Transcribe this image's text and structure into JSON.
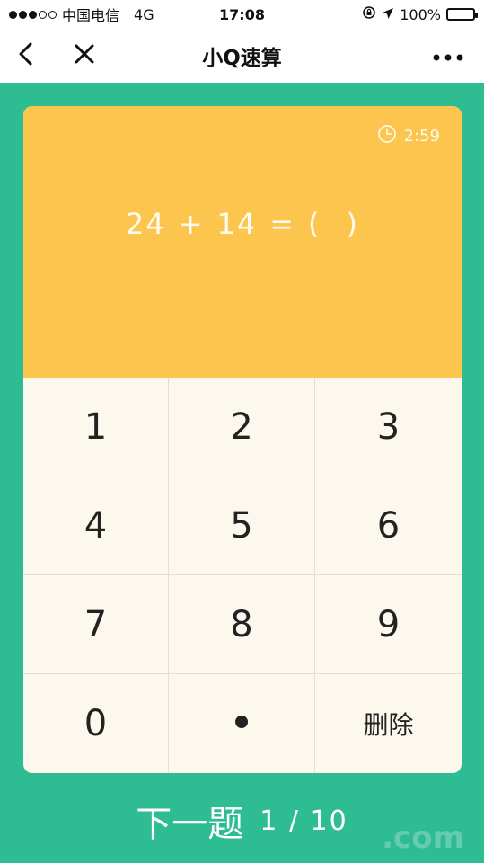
{
  "status_bar": {
    "carrier": "中国电信",
    "network": "4G",
    "time": "17:08",
    "battery_percent": "100%",
    "battery_level": 1.0,
    "signal_filled": 3,
    "signal_total": 5
  },
  "nav": {
    "title": "小Q速算",
    "back_icon": "chevron-left-icon",
    "close_icon": "close-icon",
    "more_icon": "more-dots-icon"
  },
  "question": {
    "timer": "2:59",
    "left_operand": "24",
    "operator": "+",
    "right_operand": "14",
    "equals": "=",
    "open_paren": "(",
    "close_paren": ")",
    "answer": ""
  },
  "keypad": {
    "keys": [
      "1",
      "2",
      "3",
      "4",
      "5",
      "6",
      "7",
      "8",
      "9",
      "0",
      "•",
      "删除"
    ]
  },
  "footer": {
    "next_label": "下一题",
    "current": "1",
    "separator": "/",
    "total": "10"
  },
  "watermark": {
    "text": ".com"
  },
  "colors": {
    "background": "#2ebc93",
    "question_panel": "#fcc54e",
    "keypad_bg": "#fdf8ed"
  }
}
